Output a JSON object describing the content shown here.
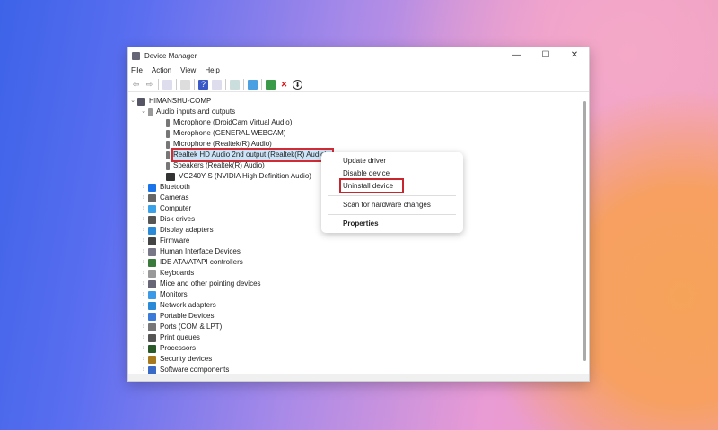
{
  "window": {
    "title": "Device Manager",
    "controls": [
      "—",
      "☐",
      "✕"
    ]
  },
  "menu": [
    "File",
    "Action",
    "View",
    "Help"
  ],
  "tree": {
    "root": "HIMANSHU-COMP",
    "audio": {
      "label": "Audio inputs and outputs",
      "children": [
        "Microphone (DroidCam Virtual Audio)",
        "Microphone (GENERAL WEBCAM)",
        "Microphone (Realtek(R) Audio)",
        "Realtek HD Audio 2nd output (Realtek(R) Audio)",
        "Speakers (Realtek(R) Audio)",
        "VG240Y S (NVIDIA High Definition Audio)"
      ]
    },
    "categories": [
      "Bluetooth",
      "Cameras",
      "Computer",
      "Disk drives",
      "Display adapters",
      "Firmware",
      "Human Interface Devices",
      "IDE ATA/ATAPI controllers",
      "Keyboards",
      "Mice and other pointing devices",
      "Monitors",
      "Network adapters",
      "Portable Devices",
      "Ports (COM & LPT)",
      "Print queues",
      "Processors",
      "Security devices",
      "Software components"
    ]
  },
  "context_menu": {
    "update": "Update driver",
    "disable": "Disable device",
    "uninstall": "Uninstall device",
    "scan": "Scan for hardware changes",
    "properties": "Properties"
  },
  "colors": {
    "highlight": "#d12b35"
  }
}
